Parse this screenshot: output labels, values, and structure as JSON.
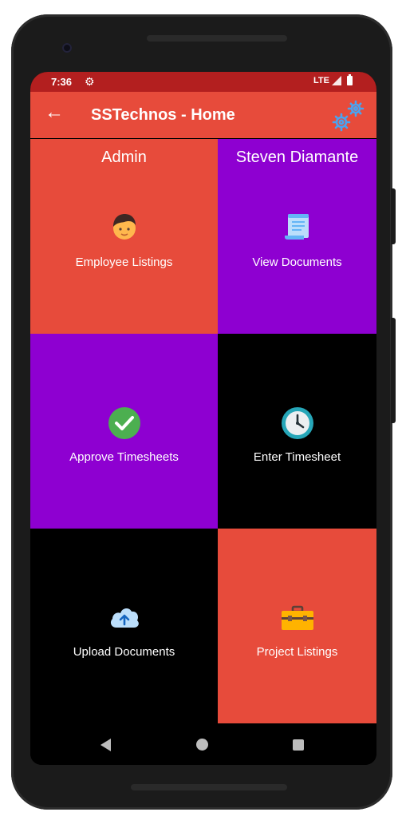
{
  "status_bar": {
    "time": "7:36",
    "network": "LTE"
  },
  "app_bar": {
    "title": "SSTechnos - Home"
  },
  "colors": {
    "red": "#e74b3b",
    "purple": "#8e00d1",
    "black": "#000000",
    "status_red": "#b31f1f"
  },
  "tiles": [
    {
      "name": "Admin",
      "label": "Employee Listings",
      "icon": "person-icon",
      "color": "#e74b3b"
    },
    {
      "name": "Steven Diamante",
      "label": "View Documents",
      "icon": "document-scroll-icon",
      "color": "#8e00d1"
    },
    {
      "name": "",
      "label": "Approve Timesheets",
      "icon": "check-circle-icon",
      "color": "#8e00d1"
    },
    {
      "name": "",
      "label": "Enter Timesheet",
      "icon": "clock-icon",
      "color": "#000000"
    },
    {
      "name": "",
      "label": "Upload Documents",
      "icon": "cloud-upload-icon",
      "color": "#000000"
    },
    {
      "name": "",
      "label": "Project Listings",
      "icon": "toolbox-icon",
      "color": "#e74b3b"
    }
  ]
}
